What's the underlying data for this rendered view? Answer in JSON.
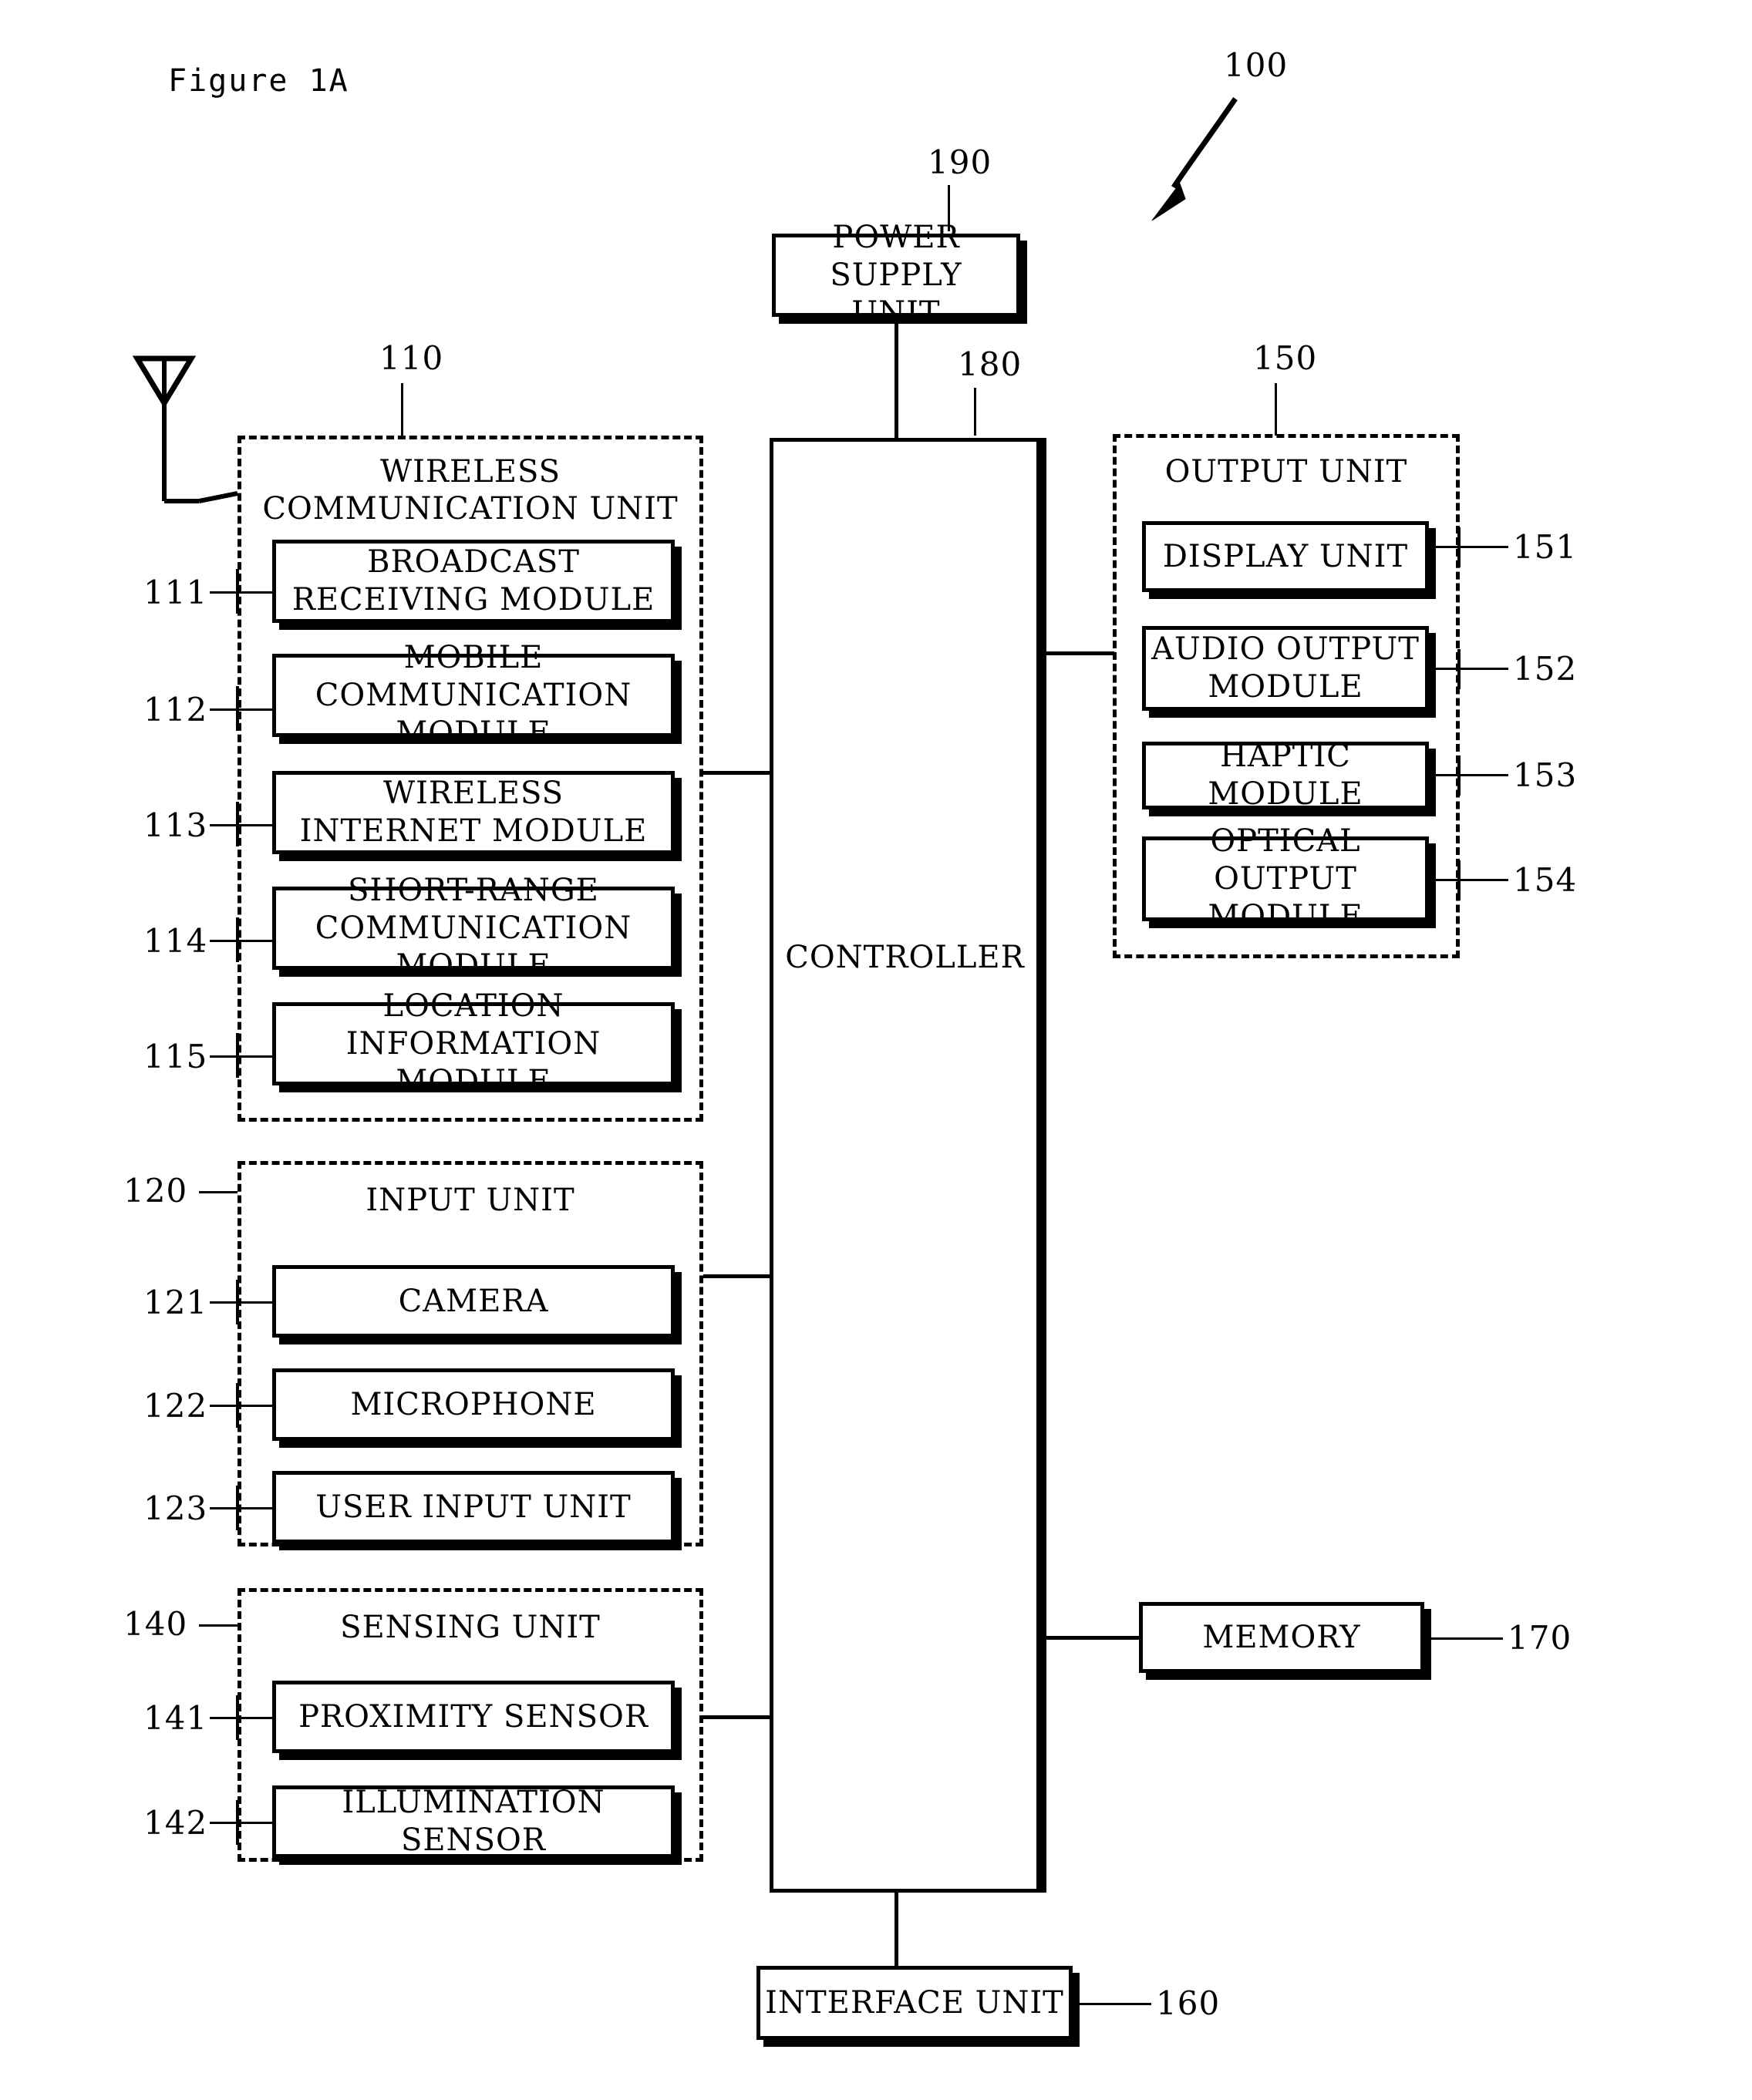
{
  "figure": {
    "title": "Figure 1A",
    "device_ref": "100"
  },
  "power_supply": {
    "label": "POWER SUPPLY\nUNIT",
    "ref": "190"
  },
  "controller": {
    "label": "CONTROLLER",
    "ref": "180"
  },
  "wireless_unit": {
    "title": "WIRELESS\nCOMMUNICATION UNIT",
    "ref": "110",
    "modules": [
      {
        "label": "BROADCAST\nRECEIVING MODULE",
        "ref": "111"
      },
      {
        "label": "MOBILE\nCOMMUNICATION MODULE",
        "ref": "112"
      },
      {
        "label": "WIRELESS\nINTERNET MODULE",
        "ref": "113"
      },
      {
        "label": "SHORT-RANGE\nCOMMUNICATION MODULE",
        "ref": "114"
      },
      {
        "label": "LOCATION\nINFORMATION MODULE",
        "ref": "115"
      }
    ]
  },
  "input_unit": {
    "title": "INPUT UNIT",
    "ref": "120",
    "modules": [
      {
        "label": "CAMERA",
        "ref": "121"
      },
      {
        "label": "MICROPHONE",
        "ref": "122"
      },
      {
        "label": "USER INPUT UNIT",
        "ref": "123"
      }
    ]
  },
  "sensing_unit": {
    "title": "SENSING UNIT",
    "ref": "140",
    "modules": [
      {
        "label": "PROXIMITY SENSOR",
        "ref": "141"
      },
      {
        "label": "ILLUMINATION SENSOR",
        "ref": "142"
      }
    ]
  },
  "output_unit": {
    "title": "OUTPUT UNIT",
    "ref": "150",
    "modules": [
      {
        "label": "DISPLAY UNIT",
        "ref": "151"
      },
      {
        "label": "AUDIO OUTPUT\nMODULE",
        "ref": "152"
      },
      {
        "label": "HAPTIC MODULE",
        "ref": "153"
      },
      {
        "label": "OPTICAL OUTPUT\nMODULE",
        "ref": "154"
      }
    ]
  },
  "memory": {
    "label": "MEMORY",
    "ref": "170"
  },
  "interface_unit": {
    "label": "INTERFACE UNIT",
    "ref": "160"
  },
  "antenna": {
    "icon": "antenna-icon"
  }
}
